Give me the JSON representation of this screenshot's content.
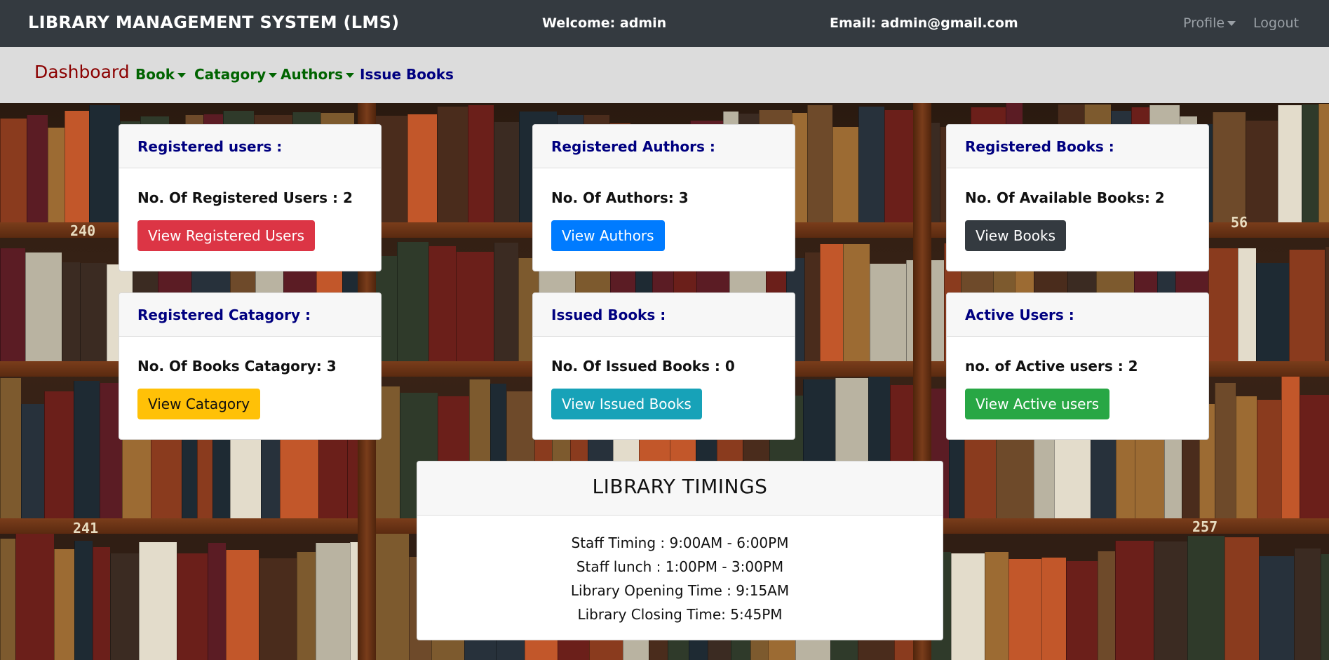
{
  "topbar": {
    "brand": "LIBRARY MANAGEMENT SYSTEM (LMS)",
    "welcome": "Welcome: admin",
    "email": "Email: admin@gmail.com",
    "profile": "Profile",
    "logout": "Logout"
  },
  "nav": {
    "dashboard": "Dashboard",
    "book": "Book",
    "catagory": "Catagory",
    "authors": "Authors",
    "issue_books": "Issue Books"
  },
  "background": {
    "shelf_labels": [
      "240",
      "56",
      "241",
      "257"
    ]
  },
  "cards": {
    "users": {
      "title": "Registered users :",
      "text": "No. Of Registered Users : 2",
      "button": "View Registered Users"
    },
    "authors": {
      "title": "Registered Authors :",
      "text": "No. Of Authors: 3",
      "button": "View Authors"
    },
    "books": {
      "title": "Registered Books :",
      "text": "No. Of Available Books: 2",
      "button": "View Books"
    },
    "catagory": {
      "title": "Registered Catagory :",
      "text": "No. Of Books Catagory: 3",
      "button": "View Catagory"
    },
    "issued": {
      "title": "Issued Books :",
      "text": "No. Of Issued Books : 0",
      "button": "View Issued Books"
    },
    "active": {
      "title": "Active Users :",
      "text": "no. of Active users : 2",
      "button": "View Active users"
    }
  },
  "timings": {
    "title": "LIBRARY TIMINGS",
    "lines": [
      "Staff Timing : 9:00AM - 6:00PM",
      "Staff lunch : 1:00PM - 3:00PM",
      "Library Opening Time : 9:15AM",
      "Library Closing Time: 5:45PM"
    ]
  },
  "colors": {
    "topbar": "#343a40",
    "navbar": "#dcdcdc",
    "card_title": "#000080",
    "dashboard": "#8b0000",
    "nav_green": "#006400"
  }
}
